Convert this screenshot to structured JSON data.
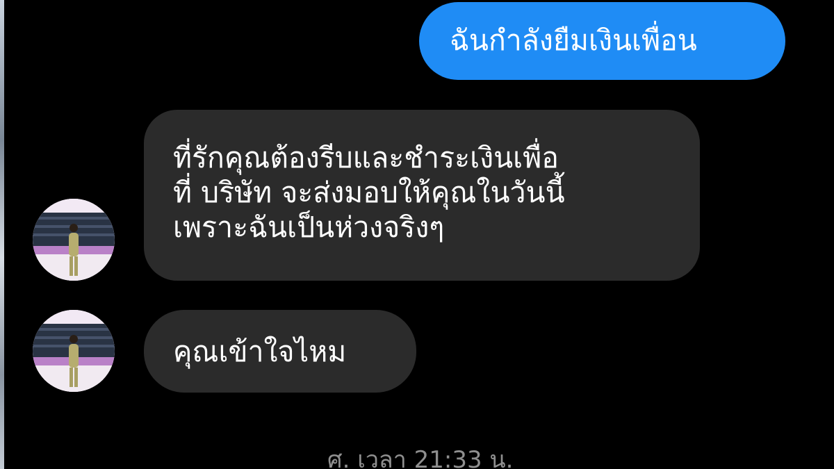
{
  "chat": {
    "messages": [
      {
        "direction": "outgoing",
        "text": "ฉันกำลังยืมเงินเพื่อน"
      },
      {
        "direction": "incoming",
        "lines": [
          "ที่รักคุณต้องรีบและชำระเงินเพื่อ",
          "ที่ บริษัท จะส่งมอบให้คุณในวันนี้",
          "เพราะฉันเป็นห่วงจริงๆ"
        ]
      },
      {
        "direction": "incoming",
        "text": "คุณเข้าใจไหม"
      }
    ],
    "timestamp": "ศ. เวลา 21:33 น."
  },
  "colors": {
    "background": "#000000",
    "outgoing_bubble": "#1f8cf5",
    "incoming_bubble": "#2b2b2b",
    "message_text": "#ffffff",
    "timestamp_text": "#8f8f8f"
  },
  "icons": {
    "avatar": "contact-avatar-photo"
  }
}
